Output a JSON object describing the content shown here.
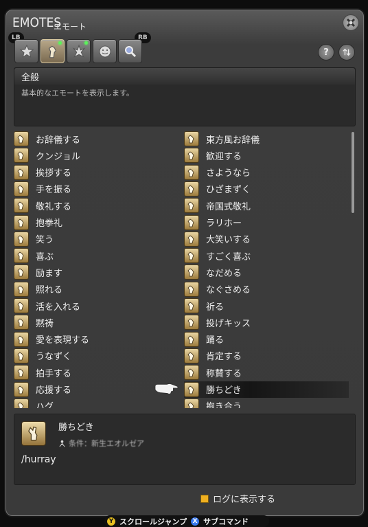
{
  "window": {
    "title": "EMOTES",
    "subtitle": "エモート"
  },
  "shoulder": {
    "lb": "LB",
    "rb": "RB"
  },
  "category": {
    "name": "全般",
    "description": "基本的なエモートを表示します。"
  },
  "emotes_left": [
    "お辞儀する",
    "クンジョル",
    "挨拶する",
    "手を振る",
    "敬礼する",
    "抱拳礼",
    "笑う",
    "喜ぶ",
    "励ます",
    "照れる",
    "活を入れる",
    "黙祷",
    "愛を表現する",
    "うなずく",
    "拍手する",
    "応援する",
    "ハグ"
  ],
  "emotes_right": [
    "東方風お辞儀",
    "歓迎する",
    "さようなら",
    "ひざまずく",
    "帝国式敬礼",
    "ラリホー",
    "大笑いする",
    "すごく喜ぶ",
    "なだめる",
    "なぐさめる",
    "祈る",
    "投げキッス",
    "踊る",
    "肯定する",
    "称賛する",
    "勝ちどき",
    "抱き合う"
  ],
  "selected_index_right": 15,
  "detail": {
    "name": "勝ちどき",
    "command": "/hurray",
    "requirement": "条件：新生エオルゼア"
  },
  "log_toggle": "ログに表示する",
  "footer": {
    "y_label": "スクロールジャンプ",
    "x_label": "サブコマンド",
    "y_btn": "Y",
    "x_btn": "X"
  },
  "colors": {
    "accent": "#f0b020",
    "new_dot": "#5bf05b",
    "y_btn": "#e8c020",
    "x_btn": "#3a7af0"
  }
}
